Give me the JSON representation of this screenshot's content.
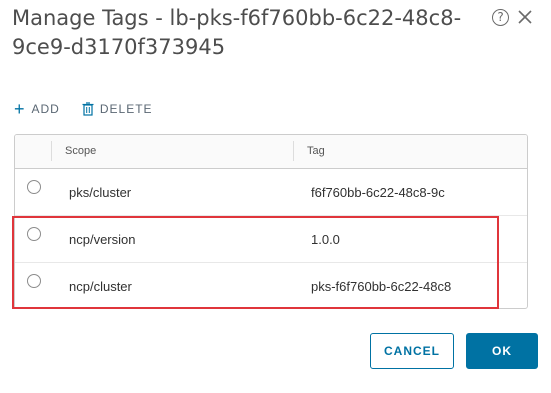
{
  "dialog": {
    "title": "Manage Tags - lb-pks-f6f760bb-6c22-48c8-9ce9-d3170f373945",
    "help_glyph": "?"
  },
  "toolbar": {
    "add_label": "ADD",
    "delete_label": "DELETE",
    "add_icon": "plus-icon",
    "delete_icon": "trash-icon"
  },
  "grid": {
    "columns": [
      "Scope",
      "Tag"
    ],
    "rows": [
      {
        "scope": "pks/cluster",
        "tag": "f6f760bb-6c22-48c8-9c"
      },
      {
        "scope": "ncp/version",
        "tag": "1.0.0"
      },
      {
        "scope": "ncp/cluster",
        "tag": "pks-f6f760bb-6c22-48c8"
      }
    ]
  },
  "footer": {
    "cancel_label": "CANCEL",
    "ok_label": "OK"
  },
  "colors": {
    "accent": "#0072a3",
    "highlight": "#e0353b"
  }
}
